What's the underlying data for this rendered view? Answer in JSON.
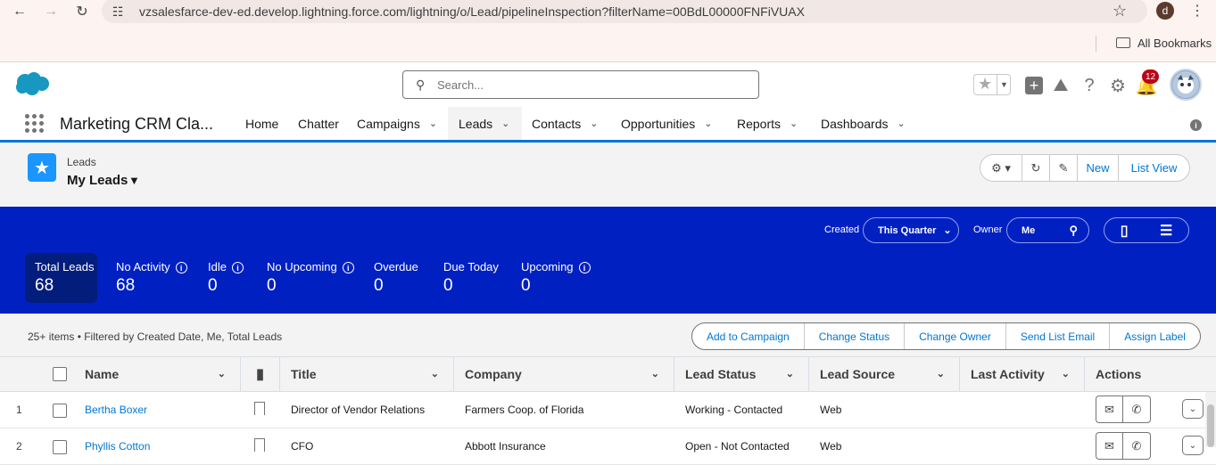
{
  "browser": {
    "url": "vzsalesfarce-dev-ed.develop.lightning.force.com/lightning/o/Lead/pipelineInspection?filterName=00BdL00000FNFiVUAX",
    "profile_initial": "d",
    "bookmarks_label": "All Bookmarks"
  },
  "header": {
    "search_placeholder": "Search...",
    "notification_count": "12"
  },
  "app": {
    "name": "Marketing CRM Cla...",
    "nav": [
      {
        "label": "Home"
      },
      {
        "label": "Chatter"
      },
      {
        "label": "Campaigns"
      },
      {
        "label": "Leads"
      },
      {
        "label": "Contacts"
      },
      {
        "label": "Opportunities"
      },
      {
        "label": "Reports"
      },
      {
        "label": "Dashboards"
      }
    ]
  },
  "listview": {
    "object": "Leads",
    "name": "My Leads",
    "buttons": {
      "new": "New",
      "list_view": "List View"
    }
  },
  "filters": {
    "created_label": "Created",
    "created_value": "This Quarter",
    "owner_label": "Owner",
    "owner_value": "Me"
  },
  "stats": [
    {
      "label": "Total Leads",
      "value": "68"
    },
    {
      "label": "No Activity",
      "value": "68"
    },
    {
      "label": "Idle",
      "value": "0"
    },
    {
      "label": "No Upcoming",
      "value": "0"
    },
    {
      "label": "Overdue",
      "value": "0"
    },
    {
      "label": "Due Today",
      "value": "0"
    },
    {
      "label": "Upcoming",
      "value": "0"
    }
  ],
  "toolbar": {
    "meta": "25+ items • Filtered by Created Date, Me, Total Leads",
    "actions": [
      "Add to Campaign",
      "Change Status",
      "Change Owner",
      "Send List Email",
      "Assign Label"
    ]
  },
  "table": {
    "columns": [
      "Name",
      "Title",
      "Company",
      "Lead Status",
      "Lead Source",
      "Last Activity",
      "Actions"
    ],
    "rows": [
      {
        "num": "1",
        "name": "Bertha Boxer",
        "title": "Director of Vendor Relations",
        "company": "Farmers Coop. of Florida",
        "status": "Working - Contacted",
        "source": "Web",
        "last_activity": ""
      },
      {
        "num": "2",
        "name": "Phyllis Cotton",
        "title": "CFO",
        "company": "Abbott Insurance",
        "status": "Open - Not Contacted",
        "source": "Web",
        "last_activity": ""
      }
    ]
  },
  "colors": {
    "brand_blue": "#0176d3",
    "band": "#0020c2",
    "band_selected": "#031d7c",
    "badge": "#ba0517"
  }
}
